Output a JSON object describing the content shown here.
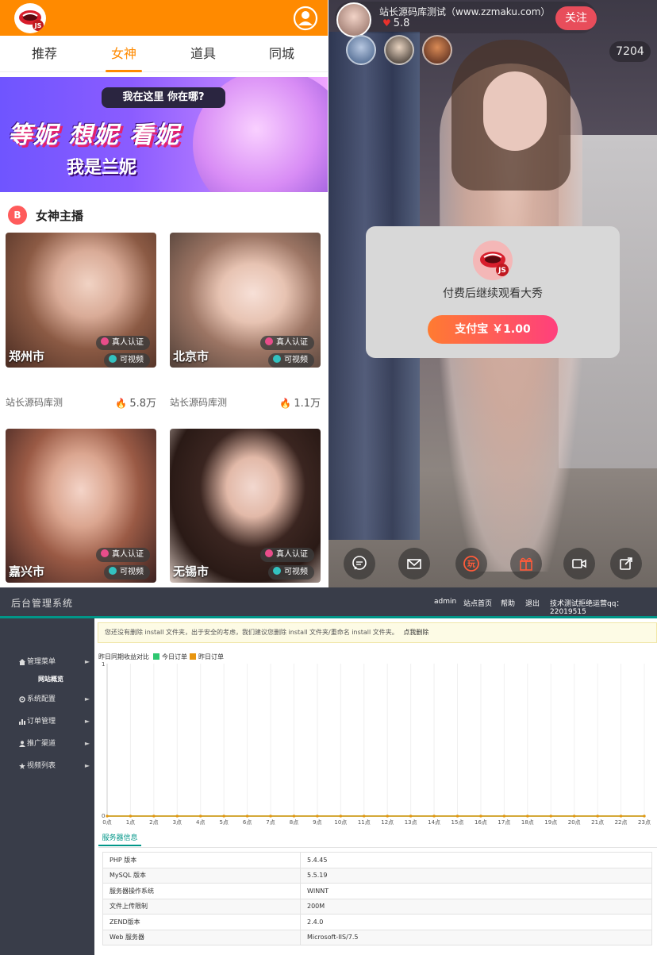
{
  "left_app": {
    "tabs": [
      {
        "label": "推荐",
        "active": false
      },
      {
        "label": "女神",
        "active": true
      },
      {
        "label": "道具",
        "active": false
      },
      {
        "label": "同城",
        "active": false
      }
    ],
    "banner": {
      "bubble": "我在这里 你在哪?",
      "headline": "等妮 想妮 看妮",
      "subline": "我是兰妮"
    },
    "section_title": "女神主播",
    "cards": [
      {
        "city": "郑州市",
        "badge_verified": "真人认证",
        "badge_video": "可视频",
        "name": "站长源码库测",
        "heat": "5.8万"
      },
      {
        "city": "北京市",
        "badge_verified": "真人认证",
        "badge_video": "可视频",
        "name": "站长源码库测",
        "heat": "1.1万"
      },
      {
        "city": "嘉兴市",
        "badge_verified": "真人认证",
        "badge_video": "可视频"
      },
      {
        "city": "无锡市",
        "badge_verified": "真人认证",
        "badge_video": "可视频"
      }
    ],
    "accent_color": "#ff8a00"
  },
  "live_room": {
    "host_name": "站长源码库测试（www.zzmaku.com）",
    "host_heat": "5.8",
    "follow_label": "关注",
    "viewer_count": "7204",
    "pay_modal": {
      "message": "付费后继续观看大秀",
      "button_label": "支付宝 ￥1.00"
    },
    "controls": [
      "chat-icon",
      "mail-icon",
      "game-icon",
      "gift-icon",
      "video-icon",
      "share-icon"
    ]
  },
  "admin": {
    "title": "后台管理系统",
    "nav": [
      "admin",
      "站点首页",
      "帮助",
      "退出",
      "技术测试拒绝运营qq：22019515"
    ],
    "sidebar": [
      {
        "label": "管理菜单",
        "icon": "home-icon"
      },
      {
        "label": "系统配置",
        "icon": "cogs-icon"
      },
      {
        "label": "订单管理",
        "icon": "bar-chart-icon"
      },
      {
        "label": "推广渠道",
        "icon": "user-icon"
      },
      {
        "label": "视频列表",
        "icon": "star-icon"
      }
    ],
    "sidebar_sub": "网站概览",
    "notice": "您还没有删除 install 文件夹，出于安全的考虑，我们建议您删除 install 文件夹/重命名 install 文件夹。",
    "notice_link": "点我删除",
    "chart_data": {
      "type": "line",
      "title": "昨日同期收益对比",
      "categories": [
        "0点",
        "1点",
        "2点",
        "3点",
        "4点",
        "5点",
        "6点",
        "7点",
        "8点",
        "9点",
        "10点",
        "11点",
        "12点",
        "13点",
        "14点",
        "15点",
        "16点",
        "17点",
        "18点",
        "19点",
        "20点",
        "21点",
        "22点",
        "23点"
      ],
      "series": [
        {
          "name": "今日订单",
          "color": "#2ec770",
          "values": [
            0,
            0,
            0,
            0,
            0,
            0,
            0,
            0,
            0,
            0,
            0,
            0,
            0,
            0,
            0,
            0,
            0,
            0,
            0,
            0,
            0,
            0,
            0,
            0
          ]
        },
        {
          "name": "昨日订单",
          "color": "#e8950e",
          "values": [
            0,
            0,
            0,
            0,
            0,
            0,
            0,
            0,
            0,
            0,
            0,
            0,
            0,
            0,
            0,
            0,
            0,
            0,
            0,
            0,
            0,
            0,
            0,
            0
          ]
        }
      ],
      "ylim": [
        0,
        1
      ],
      "yticks": [
        "0",
        "1"
      ],
      "grid": true,
      "legend": "top-left"
    },
    "info_tab": "服务器信息",
    "server_info": [
      {
        "key": "PHP 版本",
        "value": "5.4.45"
      },
      {
        "key": "MySQL 版本",
        "value": "5.5.19"
      },
      {
        "key": "服务器操作系统",
        "value": "WINNT"
      },
      {
        "key": "文件上传限制",
        "value": "200M"
      },
      {
        "key": "ZEND版本",
        "value": "2.4.0"
      },
      {
        "key": "Web 服务器",
        "value": "Microsoft-IIS/7.5"
      }
    ],
    "accent_color": "#009688"
  }
}
